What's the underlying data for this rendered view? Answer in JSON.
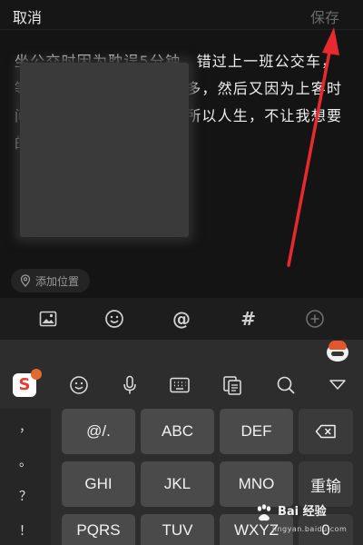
{
  "topbar": {
    "cancel": "取消",
    "save": "保存"
  },
  "editor": {
    "text": "坐公交时因为耽误5分钟，错过上一班公交车，等来一班，发现车上人很多，然后又因为上客时间长，路上好几个红灯，所以人生，不让我想要的时间太早！"
  },
  "location": {
    "label": "添加位置"
  },
  "post_toolbar": {
    "icons": [
      "image-icon",
      "emoji-icon",
      "mention-icon",
      "hashtag-icon",
      "add-icon"
    ],
    "at": "@",
    "hash": "#"
  },
  "keyboard": {
    "logo_letter": "S",
    "left_punct": [
      "，",
      "。",
      "？",
      "！"
    ],
    "rows": [
      [
        "@/.",
        "ABC",
        "DEF"
      ],
      [
        "GHI",
        "JKL",
        "MNO"
      ],
      [
        "PQRS",
        "TUV",
        "WXYZ"
      ]
    ],
    "delete_icon": "backspace-icon",
    "reenter": "重输",
    "zero": "0"
  },
  "watermark": {
    "text": "Bai 经验",
    "url": "jingyan.baidu.com"
  },
  "colors": {
    "arrow": "#e8292f",
    "cursor": "#4d7cff",
    "background": "#111111"
  }
}
